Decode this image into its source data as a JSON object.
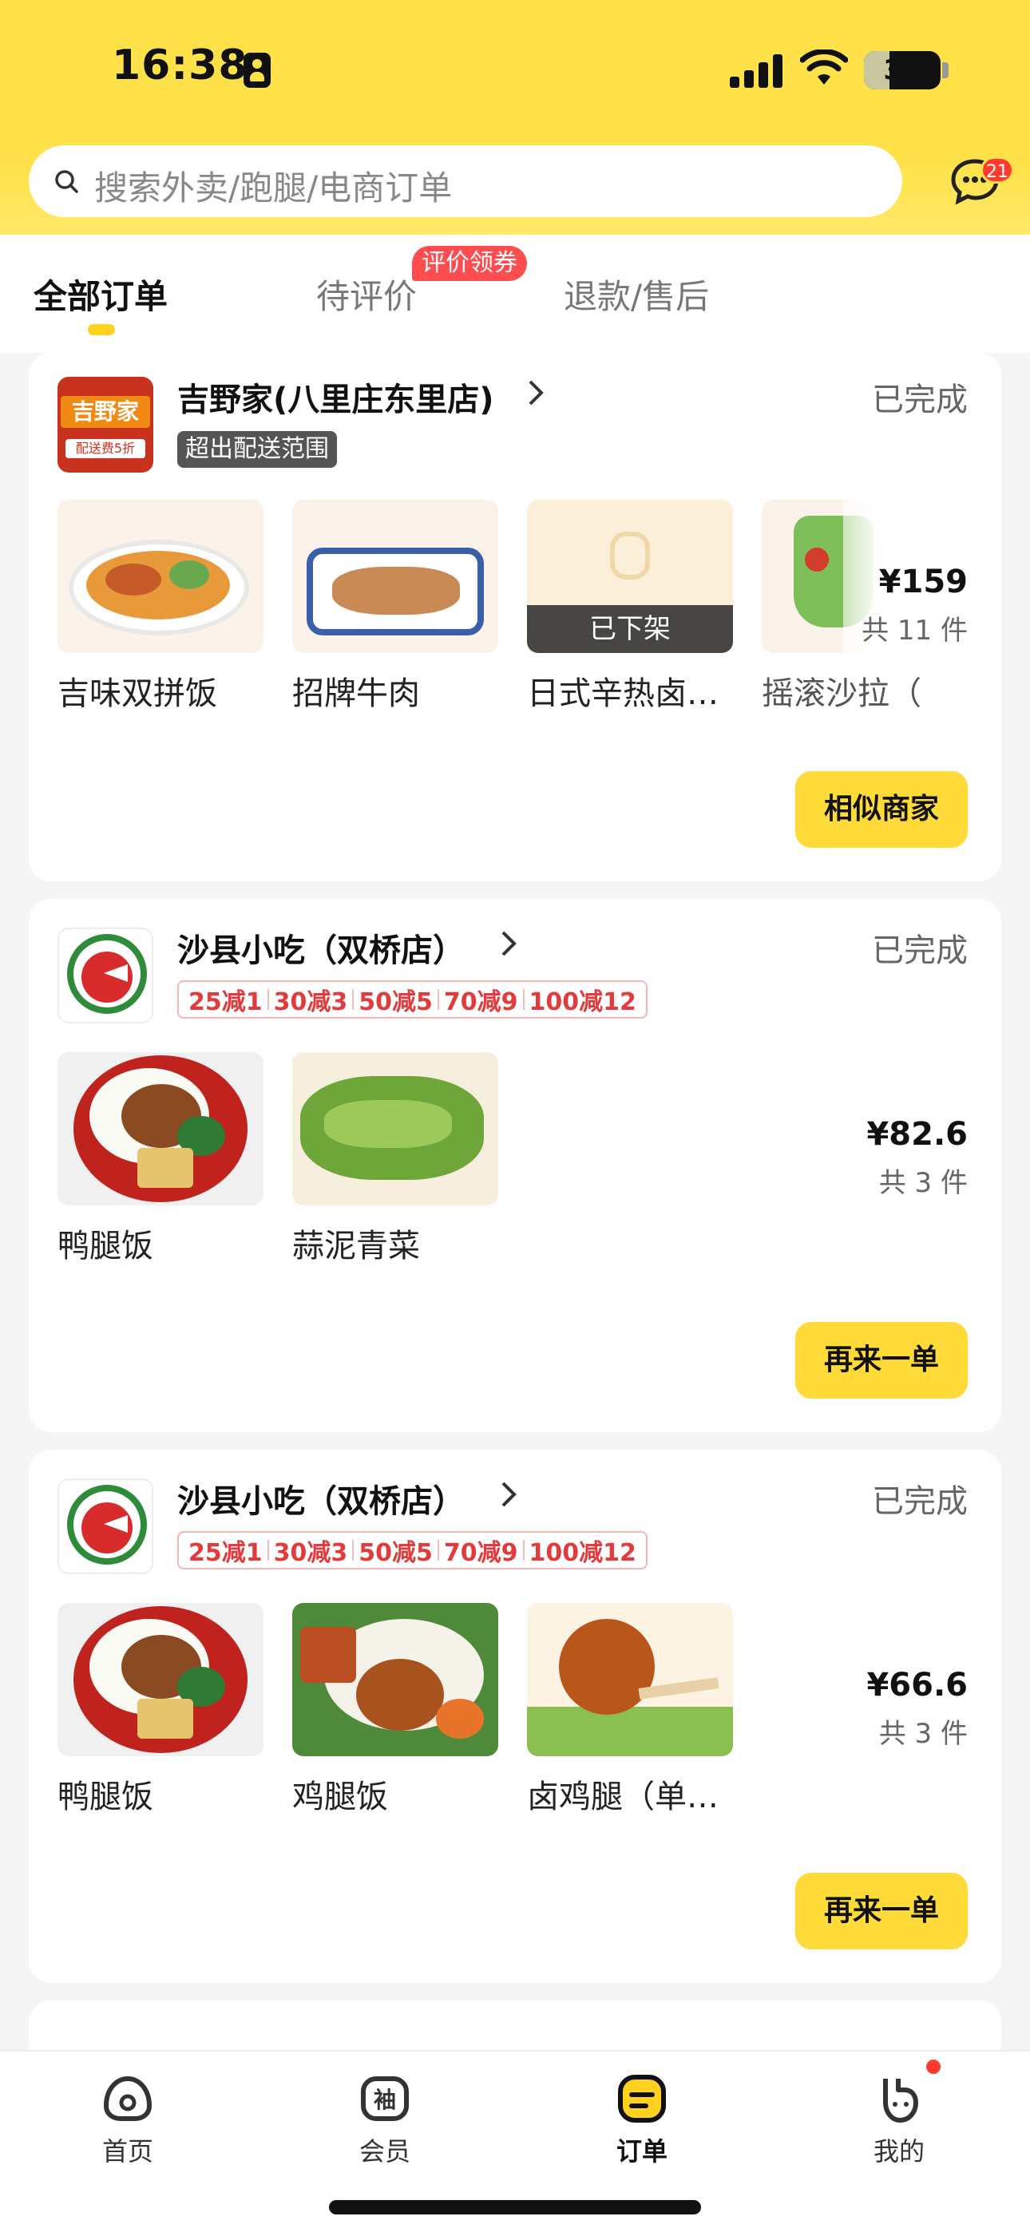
{
  "status_bar": {
    "time": "16:38",
    "battery": "33"
  },
  "search": {
    "placeholder": "搜索外卖/跑腿/电商订单"
  },
  "messages": {
    "badge": "21"
  },
  "tabs": {
    "all": "全部订单",
    "review": "待评价",
    "refund": "退款/售后",
    "review_badge": "评价领券"
  },
  "orders": [
    {
      "store": "吉野家(八里庄东里店)",
      "status": "已完成",
      "tag": "超出配送范围",
      "logo_text": "吉野家",
      "logo_sub": "配送费5折",
      "items": [
        "吉味双拼饭",
        "招牌牛肉",
        "日式辛热卤…",
        "摇滚沙拉（…"
      ],
      "off_shelf": "已下架",
      "price": "¥159",
      "count": "共 11 件",
      "action": "相似商家"
    },
    {
      "store": "沙县小吃（双桥店）",
      "status": "已完成",
      "promos": [
        "25减1",
        "30减3",
        "50减5",
        "70减9",
        "100减12"
      ],
      "items": [
        "鸭腿饭",
        "蒜泥青菜"
      ],
      "price": "¥82.6",
      "count": "共 3 件",
      "action": "再来一单"
    },
    {
      "store": "沙县小吃（双桥店）",
      "status": "已完成",
      "promos": [
        "25减1",
        "30减3",
        "50减5",
        "70减9",
        "100减12"
      ],
      "items": [
        "鸭腿饭",
        "鸡腿饭",
        "卤鸡腿（单…"
      ],
      "price": "¥66.6",
      "count": "共 3 件",
      "action": "再来一单"
    }
  ],
  "nav": {
    "home": "首页",
    "member": "会员",
    "orders": "订单",
    "mine": "我的"
  }
}
